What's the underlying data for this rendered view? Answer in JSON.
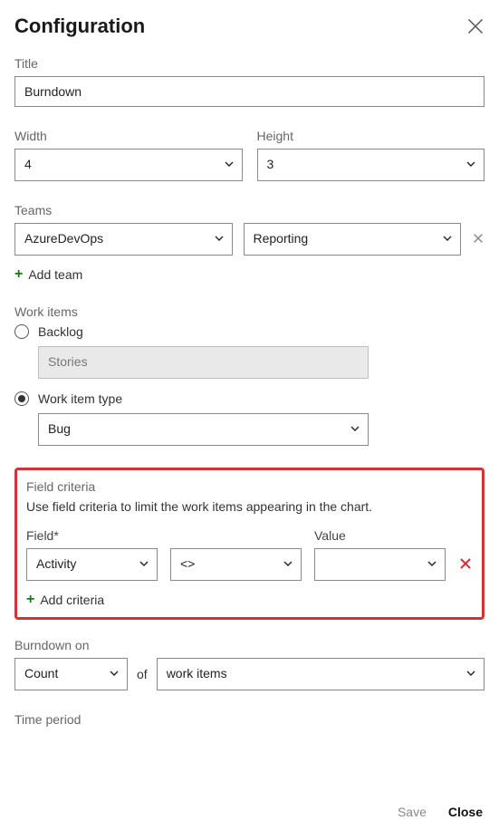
{
  "header": {
    "title": "Configuration"
  },
  "title": {
    "label": "Title",
    "value": "Burndown"
  },
  "width": {
    "label": "Width",
    "value": "4"
  },
  "height": {
    "label": "Height",
    "value": "3"
  },
  "teams": {
    "label": "Teams",
    "team1": "AzureDevOps",
    "team2": "Reporting",
    "add": "Add team"
  },
  "workItems": {
    "label": "Work items",
    "backlogLabel": "Backlog",
    "backlogValue": "Stories",
    "typeLabel": "Work item type",
    "typeValue": "Bug"
  },
  "criteria": {
    "sectionLabel": "Field criteria",
    "desc": "Use field criteria to limit the work items appearing in the chart.",
    "fieldLabel": "Field*",
    "fieldValue": "Activity",
    "opValue": "<>",
    "valueLabel": "Value",
    "valueValue": "",
    "add": "Add criteria"
  },
  "burndown": {
    "label": "Burndown on",
    "countValue": "Count",
    "ofText": "of",
    "itemsValue": "work items"
  },
  "timePeriod": {
    "label": "Time period"
  },
  "footer": {
    "save": "Save",
    "close": "Close"
  }
}
